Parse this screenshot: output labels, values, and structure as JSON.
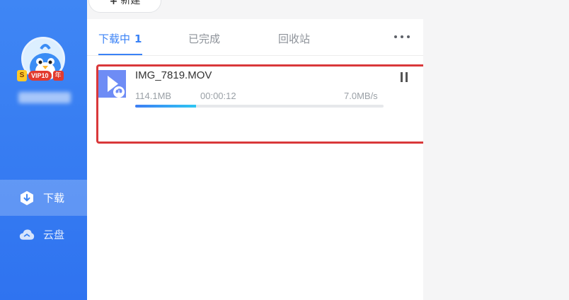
{
  "toolbar": {
    "new_label": "新建"
  },
  "user": {
    "vip_s": "S",
    "vip_label": "VIP10",
    "vip_year": "年"
  },
  "sidebar": {
    "items": [
      {
        "label": "下载",
        "icon": "download-icon",
        "active": true
      },
      {
        "label": "云盘",
        "icon": "cloud-icon",
        "active": false
      }
    ]
  },
  "tabs": [
    {
      "label": "下载中",
      "count": "1",
      "active": true
    },
    {
      "label": "已完成",
      "active": false
    },
    {
      "label": "回收站",
      "active": false
    }
  ],
  "download": {
    "file_name": "IMG_7819.MOV",
    "size": "114.1MB",
    "time": "00:00:12",
    "speed": "7.0MB/s",
    "progress": 0.245,
    "icon": "video-file-icon"
  },
  "colors": {
    "sidebar": "#3580f3",
    "accent": "#3a82f6",
    "highlight_border": "#d9383a",
    "file_icon": "#6e8cf5"
  }
}
